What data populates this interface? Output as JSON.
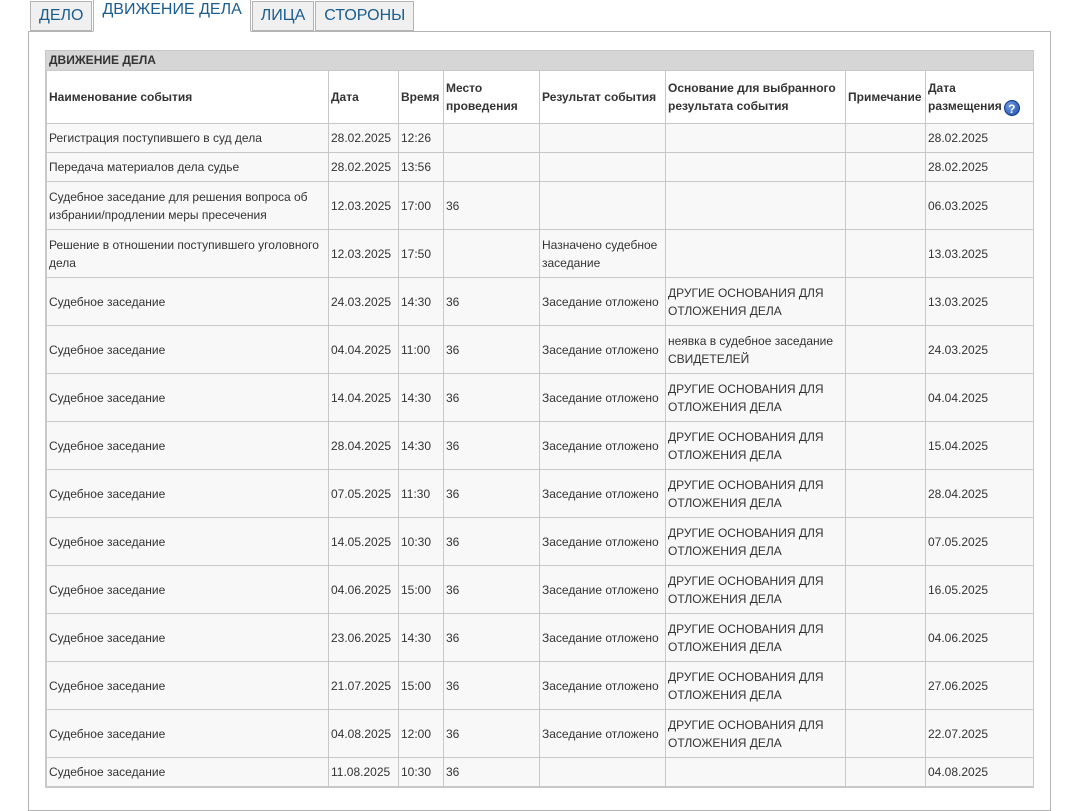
{
  "tabs": [
    {
      "label": "ДЕЛО"
    },
    {
      "label": "ДВИЖЕНИЕ ДЕЛА"
    },
    {
      "label": "ЛИЦА"
    },
    {
      "label": "СТОРОНЫ"
    }
  ],
  "section": {
    "title": "ДВИЖЕНИЕ ДЕЛА",
    "help_icon": "question-icon",
    "headers": [
      "Наименование события",
      "Дата",
      "Время",
      "Место проведения",
      "Результат события",
      "Основание для выбранного результата события",
      "Примечание",
      "Дата размещения"
    ],
    "rows": [
      [
        "Регистрация поступившего в суд дела",
        "28.02.2025",
        "12:26",
        "",
        "",
        "",
        "",
        "28.02.2025"
      ],
      [
        "Передача материалов дела судье",
        "28.02.2025",
        "13:56",
        "",
        "",
        "",
        "",
        "28.02.2025"
      ],
      [
        "Судебное заседание для решения вопроса об избрании/продлении меры пресечения",
        "12.03.2025",
        "17:00",
        "36",
        "",
        "",
        "",
        "06.03.2025"
      ],
      [
        "Решение в отношении поступившего уголовного дела",
        "12.03.2025",
        "17:50",
        "",
        "Назначено судебное заседание",
        "",
        "",
        "13.03.2025"
      ],
      [
        "Судебное заседание",
        "24.03.2025",
        "14:30",
        "36",
        "Заседание отложено",
        "ДРУГИЕ ОСНОВАНИЯ ДЛЯ ОТЛОЖЕНИЯ ДЕЛА",
        "",
        "13.03.2025"
      ],
      [
        "Судебное заседание",
        "04.04.2025",
        "11:00",
        "36",
        "Заседание отложено",
        "неявка в судебное заседание СВИДЕТЕЛЕЙ",
        "",
        "24.03.2025"
      ],
      [
        "Судебное заседание",
        "14.04.2025",
        "14:30",
        "36",
        "Заседание отложено",
        "ДРУГИЕ ОСНОВАНИЯ ДЛЯ ОТЛОЖЕНИЯ ДЕЛА",
        "",
        "04.04.2025"
      ],
      [
        "Судебное заседание",
        "28.04.2025",
        "14:30",
        "36",
        "Заседание отложено",
        "ДРУГИЕ ОСНОВАНИЯ ДЛЯ ОТЛОЖЕНИЯ ДЕЛА",
        "",
        "15.04.2025"
      ],
      [
        "Судебное заседание",
        "07.05.2025",
        "11:30",
        "36",
        "Заседание отложено",
        "ДРУГИЕ ОСНОВАНИЯ ДЛЯ ОТЛОЖЕНИЯ ДЕЛА",
        "",
        "28.04.2025"
      ],
      [
        "Судебное заседание",
        "14.05.2025",
        "10:30",
        "36",
        "Заседание отложено",
        "ДРУГИЕ ОСНОВАНИЯ ДЛЯ ОТЛОЖЕНИЯ ДЕЛА",
        "",
        "07.05.2025"
      ],
      [
        "Судебное заседание",
        "04.06.2025",
        "15:00",
        "36",
        "Заседание отложено",
        "ДРУГИЕ ОСНОВАНИЯ ДЛЯ ОТЛОЖЕНИЯ ДЕЛА",
        "",
        "16.05.2025"
      ],
      [
        "Судебное заседание",
        "23.06.2025",
        "14:30",
        "36",
        "Заседание отложено",
        "ДРУГИЕ ОСНОВАНИЯ ДЛЯ ОТЛОЖЕНИЯ ДЕЛА",
        "",
        "04.06.2025"
      ],
      [
        "Судебное заседание",
        "21.07.2025",
        "15:00",
        "36",
        "Заседание отложено",
        "ДРУГИЕ ОСНОВАНИЯ ДЛЯ ОТЛОЖЕНИЯ ДЕЛА",
        "",
        "27.06.2025"
      ],
      [
        "Судебное заседание",
        "04.08.2025",
        "12:00",
        "36",
        "Заседание отложено",
        "ДРУГИЕ ОСНОВАНИЯ ДЛЯ ОТЛОЖЕНИЯ ДЕЛА",
        "",
        "22.07.2025"
      ],
      [
        "Судебное заседание",
        "11.08.2025",
        "10:30",
        "36",
        "",
        "",
        "",
        "04.08.2025"
      ]
    ]
  }
}
